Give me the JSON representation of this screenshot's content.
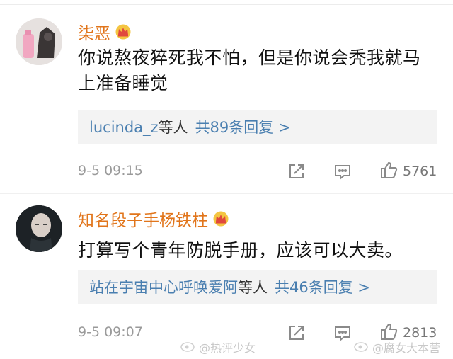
{
  "comments": [
    {
      "username": "柒恶",
      "text": "你说熬夜猝死我不怕，但是你说会秃我就马上准备睡觉",
      "replies_user": "lucinda_z",
      "replies_suffix": "等人",
      "replies_count": "共89条回复 >",
      "time": "9-5 09:15",
      "likes": "5761"
    },
    {
      "username": "知名段子手杨铁柱",
      "text": "打算写个青年防脱手册，应该可以大卖。",
      "replies_user": "站在宇宙中心呼唤爱阿",
      "replies_suffix": "等人",
      "replies_count": "共46条回复 >",
      "time": "9-5 09:07",
      "likes": "2813"
    }
  ],
  "watermarks": [
    "@热评少女",
    "@腐女大本营"
  ],
  "colors": {
    "username": "#e1751b",
    "link": "#4a7fb0",
    "meta": "#9a9a9a"
  },
  "icons": [
    "crown-badge-icon",
    "share-icon",
    "comment-icon",
    "thumbs-up-icon",
    "weibo-logo-icon"
  ]
}
